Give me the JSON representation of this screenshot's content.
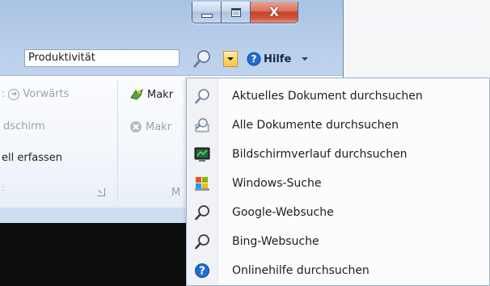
{
  "window": {
    "minimize_icon": "minimize-icon",
    "maximize_icon": "maximize-icon",
    "close_glyph": "X"
  },
  "search": {
    "value": "Produktivität"
  },
  "help": {
    "label": "Hilfe"
  },
  "ribbon": {
    "forward_label": "Vorwärts",
    "fullscreen_fragment": "dschirm",
    "macro1_fragment": "Makr",
    "macro2_fragment": "Makr",
    "capture_fragment": "ell erfassen",
    "group_fragment": "M"
  },
  "menu": {
    "items": [
      {
        "label": "Aktuelles Dokument durchsuchen",
        "icon": "magnifier-icon"
      },
      {
        "label": "Alle Dokumente durchsuchen",
        "icon": "documents-search-icon"
      },
      {
        "label": "Bildschirmverlauf durchsuchen",
        "icon": "screen-history-icon"
      },
      {
        "label": "Windows-Suche",
        "icon": "windows-search-icon"
      },
      {
        "label": "Google-Websuche",
        "icon": "google-search-icon"
      },
      {
        "label": "Bing-Websuche",
        "icon": "bing-search-icon"
      },
      {
        "label": "Onlinehilfe durchsuchen",
        "icon": "help-icon"
      }
    ]
  },
  "colors": {
    "accent": "#ffc53d",
    "help_blue": "#1f6fd1",
    "close_red": "#c6452a"
  }
}
